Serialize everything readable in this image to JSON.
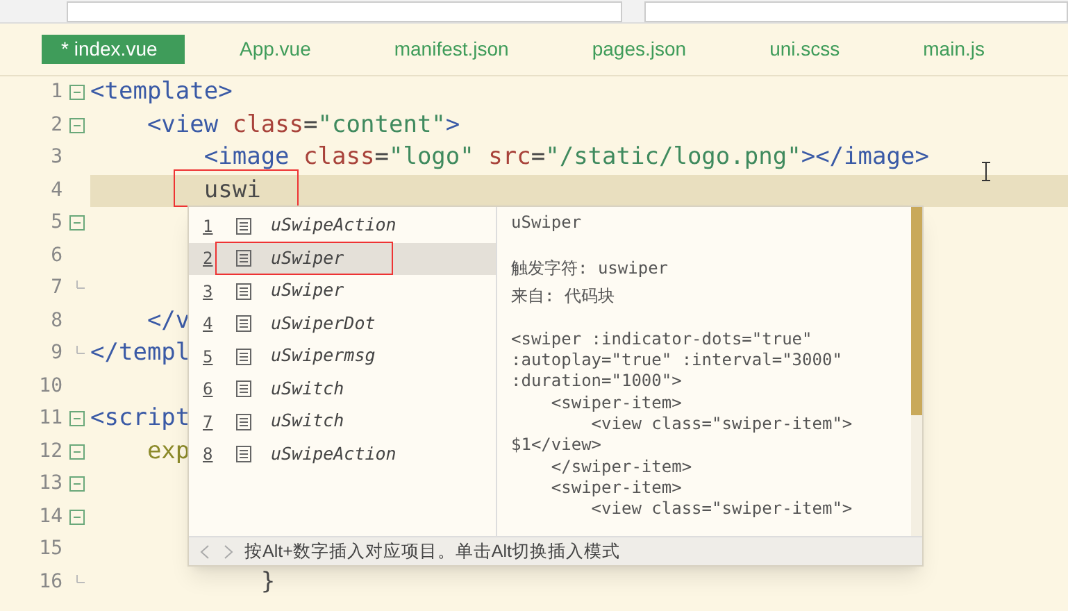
{
  "tabs": [
    {
      "label": "* index.vue",
      "selected": true
    },
    {
      "label": "App.vue",
      "selected": false
    },
    {
      "label": "manifest.json",
      "selected": false
    },
    {
      "label": "pages.json",
      "selected": false
    },
    {
      "label": "uni.scss",
      "selected": false
    },
    {
      "label": "main.js",
      "selected": false
    }
  ],
  "editor": {
    "lines": [
      {
        "number": "1",
        "fold_marker": true,
        "block_end": false,
        "current": false,
        "tokens": [
          {
            "kind": "tag",
            "text": "<template>"
          }
        ]
      },
      {
        "number": "2",
        "fold_marker": true,
        "block_end": false,
        "current": false,
        "tokens": [
          {
            "kind": "tag",
            "text": "    <view"
          },
          {
            "kind": "attr",
            "text": " class"
          },
          {
            "kind": "plain",
            "text": "="
          },
          {
            "kind": "string",
            "text": "\"content\""
          },
          {
            "kind": "tag",
            "text": ">"
          }
        ]
      },
      {
        "number": "3",
        "fold_marker": false,
        "block_end": false,
        "current": false,
        "tokens": [
          {
            "kind": "tag",
            "text": "        <image"
          },
          {
            "kind": "attr",
            "text": " class"
          },
          {
            "kind": "plain",
            "text": "="
          },
          {
            "kind": "string",
            "text": "\"logo\""
          },
          {
            "kind": "attr",
            "text": " src"
          },
          {
            "kind": "plain",
            "text": "="
          },
          {
            "kind": "string",
            "text": "\"/static/logo.png\""
          },
          {
            "kind": "tag",
            "text": "></image>"
          }
        ]
      },
      {
        "number": "4",
        "fold_marker": false,
        "block_end": false,
        "current": true,
        "tokens": [
          {
            "kind": "plain",
            "text": "        uswi"
          }
        ]
      },
      {
        "number": "5",
        "fold_marker": true,
        "block_end": false,
        "current": false
      },
      {
        "number": "6",
        "fold_marker": false,
        "block_end": false,
        "current": false
      },
      {
        "number": "7",
        "fold_marker": false,
        "block_end": true,
        "current": false
      },
      {
        "number": "8",
        "fold_marker": false,
        "block_end": false,
        "current": false,
        "tokens": [
          {
            "kind": "tag",
            "text": "    </v"
          }
        ]
      },
      {
        "number": "9",
        "fold_marker": false,
        "block_end": true,
        "current": false,
        "tokens": [
          {
            "kind": "tag",
            "text": "</templ"
          }
        ]
      },
      {
        "number": "10",
        "fold_marker": false,
        "block_end": false,
        "current": false
      },
      {
        "number": "11",
        "fold_marker": true,
        "block_end": false,
        "current": false,
        "tokens": [
          {
            "kind": "tag",
            "text": "<script"
          }
        ]
      },
      {
        "number": "12",
        "fold_marker": true,
        "block_end": false,
        "current": false,
        "tokens": [
          {
            "kind": "keyword",
            "text": "    exp"
          }
        ]
      },
      {
        "number": "13",
        "fold_marker": true,
        "block_end": false,
        "current": false
      },
      {
        "number": "14",
        "fold_marker": true,
        "block_end": false,
        "current": false
      },
      {
        "number": "15",
        "fold_marker": false,
        "block_end": false,
        "current": false
      },
      {
        "number": "16",
        "fold_marker": false,
        "block_end": true,
        "current": false,
        "tokens": [
          {
            "kind": "plain",
            "text": "            }"
          }
        ]
      }
    ]
  },
  "autocomplete": {
    "items": [
      {
        "index": "1",
        "label": "uSwipeAction",
        "selected": false
      },
      {
        "index": "2",
        "label": "uSwiper",
        "selected": true
      },
      {
        "index": "3",
        "label": "uSwiper",
        "selected": false
      },
      {
        "index": "4",
        "label": "uSwiperDot",
        "selected": false
      },
      {
        "index": "5",
        "label": "uSwipermsg",
        "selected": false
      },
      {
        "index": "6",
        "label": "uSwitch",
        "selected": false
      },
      {
        "index": "7",
        "label": "uSwitch",
        "selected": false
      },
      {
        "index": "8",
        "label": "uSwipeAction",
        "selected": false
      }
    ],
    "doc": {
      "title": "uSwiper",
      "trigger": "触发字符: uswiper",
      "source": "来自: 代码块",
      "snippet": [
        "<swiper :indicator-dots=\"true\"",
        ":autoplay=\"true\" :interval=\"3000\"",
        ":duration=\"1000\">",
        "    <swiper-item>",
        "        <view class=\"swiper-item\">",
        "$1</view>",
        "    </swiper-item>",
        "    <swiper-item>",
        "        <view class=\"swiper-item\">"
      ]
    },
    "footer": "按Alt+数字插入对应项目。单击Alt切换插入模式"
  }
}
